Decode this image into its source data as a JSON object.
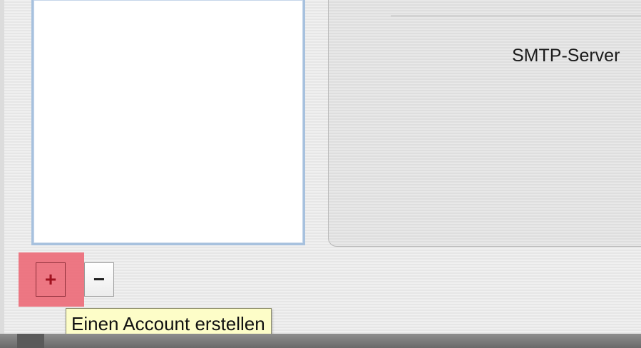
{
  "detail": {
    "smtp_label": "SMTP-Server"
  },
  "toolbar": {
    "add_symbol": "+",
    "remove_symbol": "−"
  },
  "tooltip": {
    "text": "Einen Account erstellen"
  },
  "colors": {
    "highlight": "#ec6270",
    "tooltip_bg": "#fdfdc8",
    "list_border": "#a7c1de"
  },
  "icons": {
    "add": "plus-icon",
    "remove": "minus-icon"
  }
}
